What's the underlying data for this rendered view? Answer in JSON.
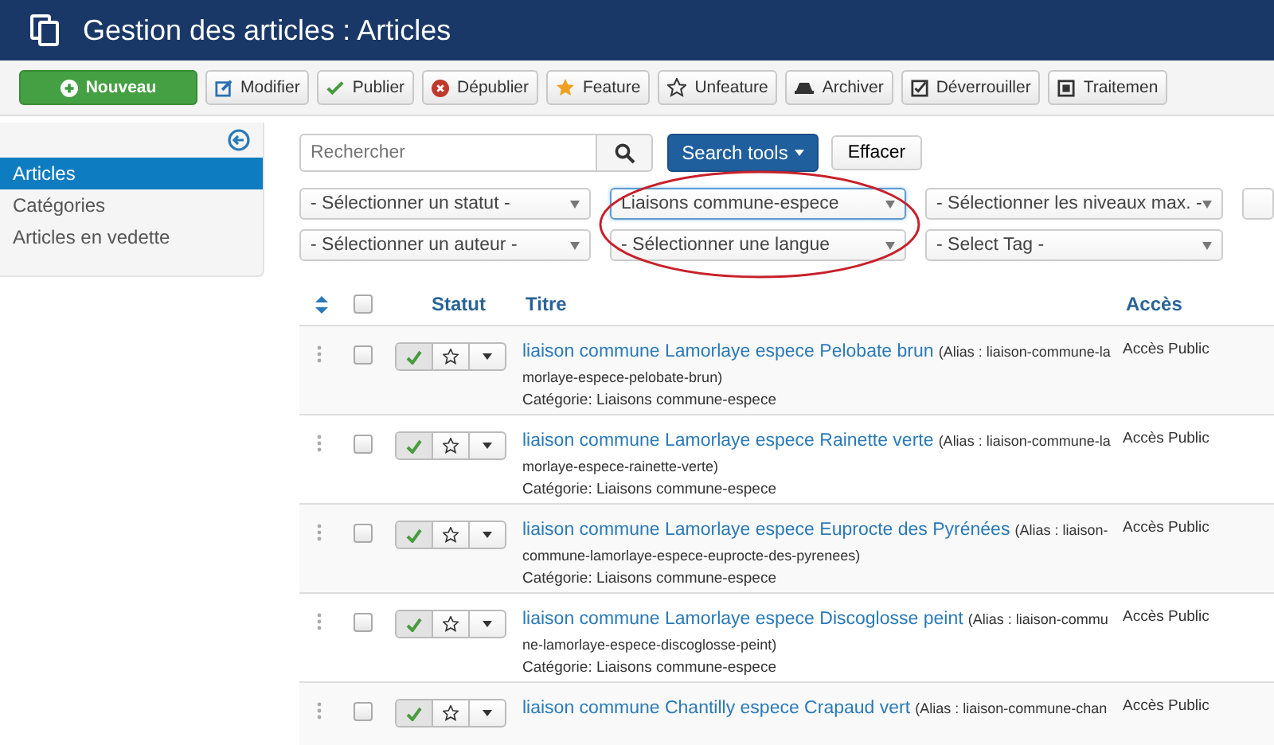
{
  "header": {
    "title": "Gestion des articles : Articles"
  },
  "toolbar": [
    {
      "label": "Nouveau",
      "kind": "new"
    },
    {
      "label": "Modifier",
      "kind": "edit"
    },
    {
      "label": "Publier",
      "kind": "publish"
    },
    {
      "label": "Dépublier",
      "kind": "unpublish"
    },
    {
      "label": "Feature",
      "kind": "feature"
    },
    {
      "label": "Unfeature",
      "kind": "unfeature"
    },
    {
      "label": "Archiver",
      "kind": "archive"
    },
    {
      "label": "Déverrouiller",
      "kind": "checkin"
    },
    {
      "label": "Traitemen",
      "kind": "batch"
    }
  ],
  "sidebar": {
    "items": [
      {
        "label": "Articles",
        "selected": true
      },
      {
        "label": "Catégories",
        "selected": false
      },
      {
        "label": "Articles en vedette",
        "selected": false
      }
    ]
  },
  "search": {
    "placeholder": "Rechercher",
    "tools_label": "Search tools",
    "clear_label": "Effacer"
  },
  "filters": [
    {
      "value": "- Sélectionner un statut -",
      "active": false
    },
    {
      "value": "Liaisons commune-espece",
      "active": true
    },
    {
      "value": "- Sélectionner les niveaux max. -",
      "active": false
    },
    {
      "active": false
    },
    {
      "value": "- Sélectionner un auteur -",
      "active": false
    },
    {
      "value": "- Sélectionner une langue",
      "active": false
    },
    {
      "value": "- Select Tag -",
      "active": false
    }
  ],
  "table": {
    "columns": [
      "Statut",
      "Titre",
      "Accès"
    ],
    "select_all_checked": false,
    "rows": [
      {
        "title": "liaison commune Lamorlaye espece Pelobate brun",
        "alias": "(Alias : liaison-commune-lamorlaye-espece-pelobate-brun)",
        "category": "Catégorie: Liaisons commune-espece",
        "access": "Accès Public",
        "published": true,
        "featured": false,
        "checked": false
      },
      {
        "title": "liaison commune Lamorlaye espece Rainette verte",
        "alias": "(Alias : liaison-commune-lamorlaye-espece-rainette-verte)",
        "category": "Catégorie: Liaisons commune-espece",
        "access": "Accès Public",
        "published": true,
        "featured": false,
        "checked": false
      },
      {
        "title": "liaison commune Lamorlaye espece Euprocte des Pyrénées",
        "alias": "(Alias : liaison-commune-lamorlaye-espece-euprocte-des-pyrenees)",
        "category": "Catégorie: Liaisons commune-espece",
        "access": "Accès Public",
        "published": true,
        "featured": false,
        "checked": false
      },
      {
        "title": "liaison commune Lamorlaye espece Discoglosse peint",
        "alias": "(Alias : liaison-commune-lamorlaye-espece-discoglosse-peint)",
        "category": "Catégorie: Liaisons commune-espece",
        "access": "Accès Public",
        "published": true,
        "featured": false,
        "checked": false
      },
      {
        "title": "liaison commune Chantilly espece Crapaud vert",
        "alias": "(Alias : liaison-commune-chan",
        "access": "Accès Public",
        "published": true,
        "featured": false,
        "checked": false
      }
    ]
  }
}
